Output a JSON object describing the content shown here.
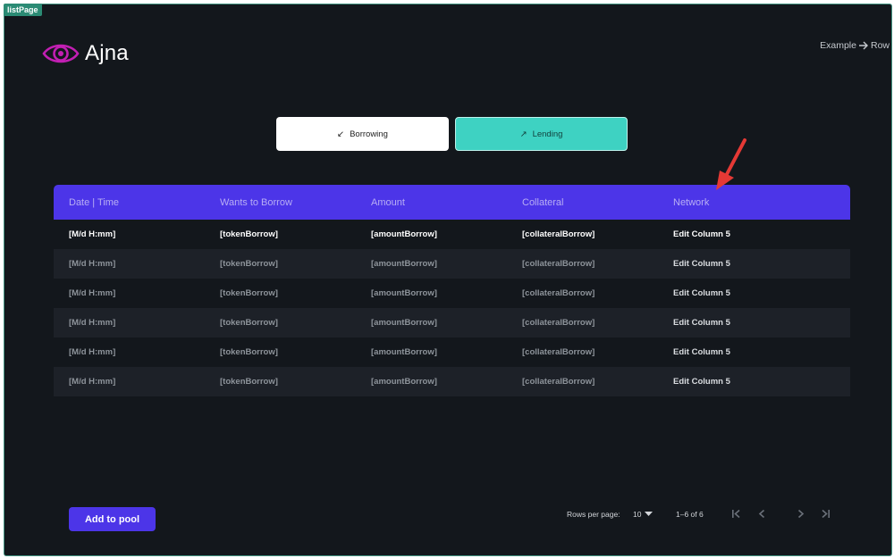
{
  "frame": {
    "tag": "listPage"
  },
  "brand": {
    "name": "Ajna",
    "icon": "eye-icon",
    "color": "#c21fb3"
  },
  "breadcrumb": {
    "first": "Example",
    "separator_icon": "arrow-right-icon",
    "second": "Row"
  },
  "toggle": {
    "borrow_label": "Borrowing",
    "borrow_icon": "↙",
    "lend_label": "Lending",
    "lend_icon": "↗",
    "active": "Lending"
  },
  "table": {
    "columns": [
      "Date | Time",
      "Wants to Borrow",
      "Amount",
      "Collateral",
      "Network"
    ],
    "rows": [
      [
        "[M/d H:mm]",
        "[tokenBorrow]",
        "[amountBorrow]",
        "[collateralBorrow]",
        "Edit Column 5"
      ],
      [
        "[M/d H:mm]",
        "[tokenBorrow]",
        "[amountBorrow]",
        "[collateralBorrow]",
        "Edit Column 5"
      ],
      [
        "[M/d H:mm]",
        "[tokenBorrow]",
        "[amountBorrow]",
        "[collateralBorrow]",
        "Edit Column 5"
      ],
      [
        "[M/d H:mm]",
        "[tokenBorrow]",
        "[amountBorrow]",
        "[collateralBorrow]",
        "Edit Column 5"
      ],
      [
        "[M/d H:mm]",
        "[tokenBorrow]",
        "[amountBorrow]",
        "[collateralBorrow]",
        "Edit Column 5"
      ],
      [
        "[M/d H:mm]",
        "[tokenBorrow]",
        "[amountBorrow]",
        "[collateralBorrow]",
        "Edit Column 5"
      ]
    ]
  },
  "footer": {
    "add_button": "Add to pool",
    "rows_per_page_label": "Rows per page:",
    "rows_per_page_value": "10",
    "range": "1–6 of 6",
    "nav_icons": {
      "first": "first-page-icon",
      "prev": "chevron-left-icon",
      "next": "chevron-right-icon",
      "last": "last-page-icon"
    }
  },
  "colors": {
    "background": "#13171c",
    "accent": "#4c35e8",
    "teal": "#3ed2c2",
    "annotation_arrow": "#e53935"
  }
}
